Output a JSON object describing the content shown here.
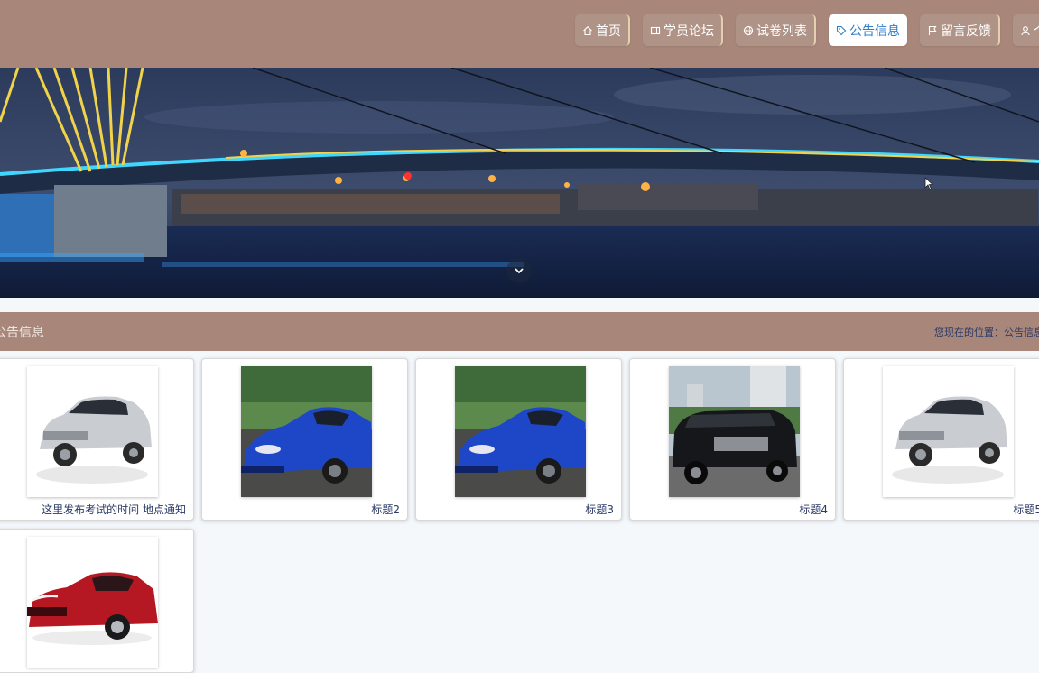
{
  "nav": {
    "items": [
      {
        "label": "首页",
        "icon": "home-icon",
        "active": false
      },
      {
        "label": "学员论坛",
        "icon": "forum-icon",
        "active": false
      },
      {
        "label": "试卷列表",
        "icon": "globe-icon",
        "active": false
      },
      {
        "label": "公告信息",
        "icon": "tag-icon",
        "active": true
      },
      {
        "label": "留言反馈",
        "icon": "flag-icon",
        "active": false
      },
      {
        "label": "个人",
        "icon": "user-icon",
        "active": false
      }
    ]
  },
  "section": {
    "title": "公告信息",
    "breadcrumb": "您现在的位置：公告信息"
  },
  "cards": [
    {
      "title": "这里发布考试的时间 地点通知",
      "image": "silver-suv"
    },
    {
      "title": "标题2",
      "image": "blue-sports-car"
    },
    {
      "title": "标题3",
      "image": "blue-sports-car"
    },
    {
      "title": "标题4",
      "image": "black-suv"
    },
    {
      "title": "标题5",
      "image": "silver-suv"
    },
    {
      "title": "",
      "image": "red-sedan"
    }
  ],
  "colors": {
    "header_bg": "#a8877a",
    "active_text": "#2f7ec8",
    "link_text": "#2b3a66",
    "page_bg": "#f4f8fb"
  }
}
